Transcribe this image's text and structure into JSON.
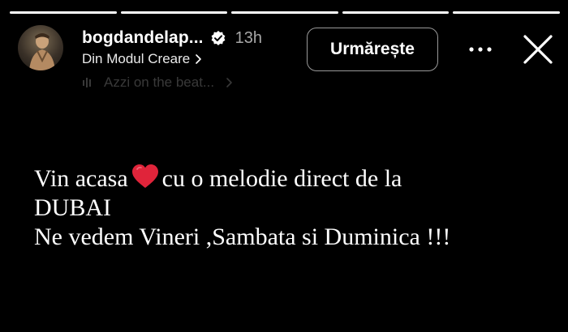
{
  "progress": {
    "segments": [
      1,
      1,
      1,
      1,
      1
    ]
  },
  "header": {
    "username": "bogdandelap...",
    "time": "13h",
    "subline": "Din Modul Creare",
    "music": "Azzi on the beat...",
    "follow_label": "Urmărește"
  },
  "story": {
    "line1_part1": "Vin acasa",
    "line1_part2": "cu o melodie direct de la",
    "line2": "DUBAI",
    "line3": "Ne vedem Vineri ,Sambata si Duminica !!!"
  },
  "icons": {
    "verified": "verified-badge-icon",
    "heart": "red-heart-icon",
    "more": "more-dots-icon",
    "close": "close-icon"
  },
  "colors": {
    "background": "#000000",
    "text": "#ffffff",
    "heart": "#e0243a"
  }
}
